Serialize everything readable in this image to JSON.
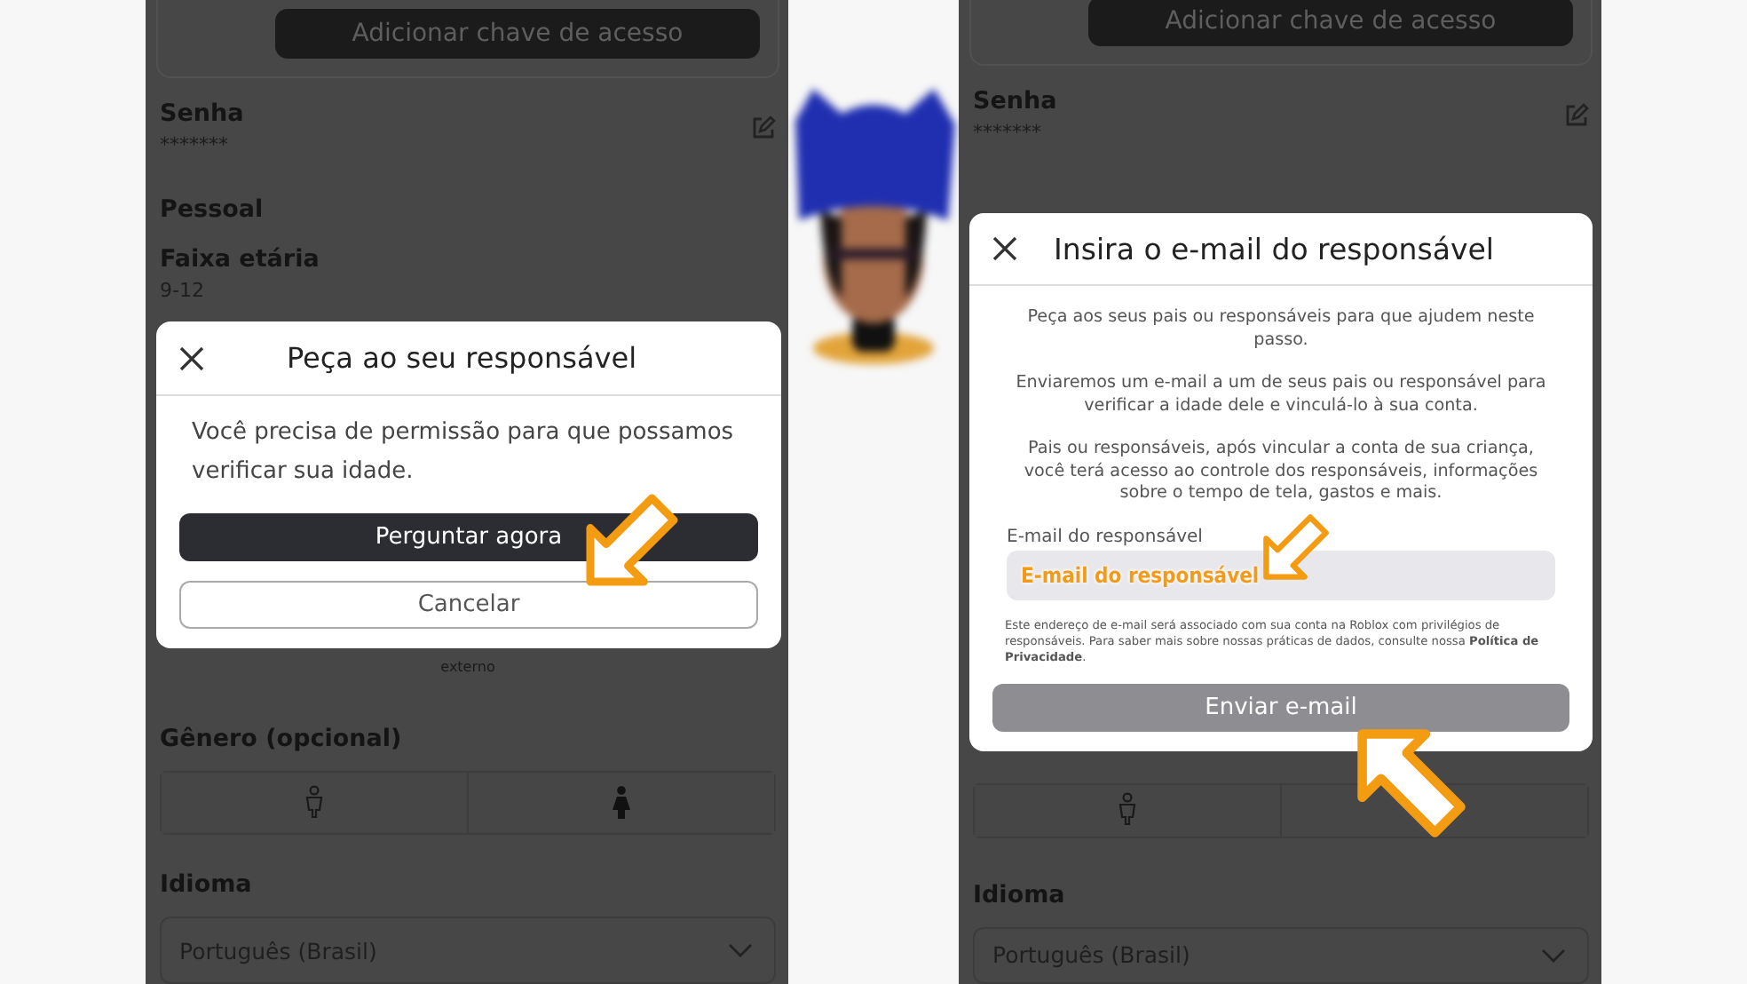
{
  "screens": [
    {
      "passkey_button": "Adicionar chave de acesso",
      "password": {
        "label": "Senha",
        "value": "*******"
      },
      "section": "Pessoal",
      "age": {
        "label": "Faixa etária",
        "value": "9-12"
      },
      "behind_text": "externo",
      "gender": {
        "label": "Gênero (opcional)",
        "options": [
          {
            "kind": "male"
          },
          {
            "kind": "female"
          }
        ]
      },
      "language": {
        "label": "Idioma",
        "value": "Português (Brasil)"
      },
      "dialog": {
        "kind": "ask",
        "title": "Peça ao seu responsável",
        "message": "Você precisa de permissão para que possamos verificar sua idade.",
        "buttons": [
          {
            "label": "Perguntar agora",
            "kind": "primary"
          },
          {
            "label": "Cancelar",
            "kind": "secondary"
          }
        ]
      }
    },
    {
      "passkey_button": "Adicionar chave de acesso",
      "password": {
        "label": "Senha",
        "value": "*******"
      },
      "gender": {
        "options": [
          {
            "kind": "male"
          },
          {
            "kind": "covered"
          }
        ]
      },
      "language": {
        "label": "Idioma",
        "value": "Português (Brasil)"
      },
      "dialog": {
        "kind": "email",
        "title": "Insira o e-mail do responsável",
        "paragraphs": [
          "Peça aos seus pais ou responsáveis para que ajudem neste passo.",
          "Enviaremos um e-mail a um de seus pais ou responsável para verificar a idade dele e vinculá-lo à sua conta.",
          "Pais ou responsáveis, após vincular a conta de sua criança, você terá acesso ao controle dos responsáveis, informações sobre o tempo de tela, gastos e mais."
        ],
        "field": {
          "label": "E-mail do responsável",
          "value": "E-mail do responsável"
        },
        "notice": "Este endereço de e-mail será associado com sua conta na Roblox com privilégios de responsáveis. Para saber mais sobre nossas práticas de dados, consulte nossa **Política de Privacidade**.",
        "buttons": [
          {
            "label": "Enviar e-mail",
            "kind": "disabled"
          }
        ]
      }
    }
  ]
}
